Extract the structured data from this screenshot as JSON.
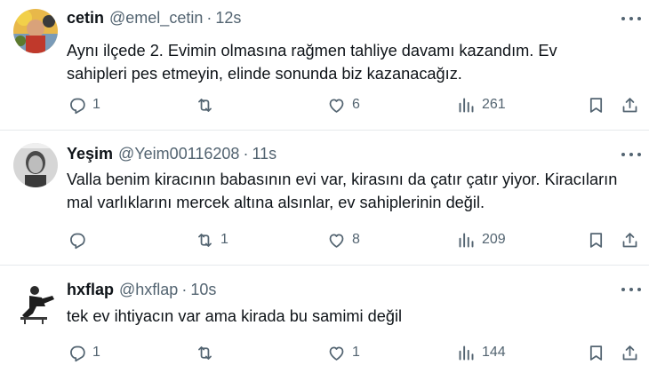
{
  "tweets": [
    {
      "name": "cetin",
      "handle": "@emel_cetin",
      "separator": "·",
      "time": "12s",
      "text_lines": [
        "Aynı ilçede 2. Evimin olmasına rağmen tahliye davamı kazandım. Ev",
        "sahipleri pes etmeyin, elinde sonunda biz kazanacağız."
      ],
      "replies": "1",
      "retweets": "",
      "likes": "6",
      "views": "261"
    },
    {
      "name": "Yeşim",
      "handle": "@Yeim00116208",
      "separator": "·",
      "time": "11s",
      "text_lines": [
        "Valla benim kiracının babasının evi var, kirasını da çatır çatır yiyor. Kiracıların",
        "mal varlıklarını mercek altına alsınlar, ev sahiplerinin değil."
      ],
      "replies": "",
      "retweets": "1",
      "likes": "8",
      "views": "209"
    },
    {
      "name": "hxflap",
      "handle": "@hxflap",
      "separator": "·",
      "time": "10s",
      "text_lines": [
        "tek ev ihtiyacın var ama kirada bu samimi değil"
      ],
      "replies": "1",
      "retweets": "",
      "likes": "1",
      "views": "144"
    }
  ],
  "icons": {
    "reply": "reply-icon",
    "retweet": "retweet-icon",
    "like": "heart-icon",
    "views": "views-chart-icon",
    "bookmark": "bookmark-icon",
    "share": "share-icon",
    "more": "more-dots-icon"
  },
  "colors": {
    "text": "#0f1419",
    "muted": "#536471",
    "divider": "#e6e9ec"
  }
}
